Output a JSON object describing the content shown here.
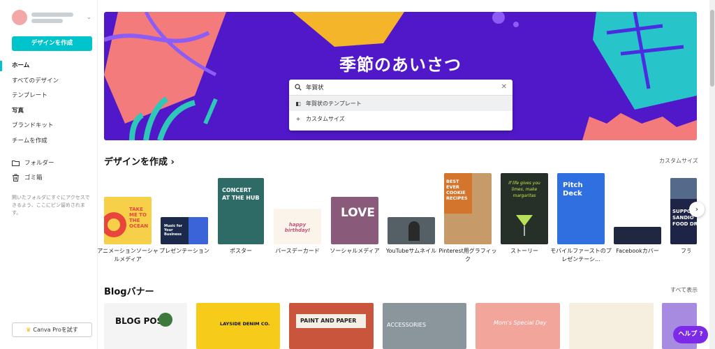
{
  "sidebar": {
    "create_button": "デザインを作成",
    "nav": [
      {
        "label": "ホーム",
        "active": true
      },
      {
        "label": "すべてのデザイン"
      },
      {
        "label": "テンプレート"
      },
      {
        "label": "写真",
        "bold": true
      },
      {
        "label": "ブランドキット"
      },
      {
        "label": "チームを作成"
      }
    ],
    "folders": "フォルダー",
    "trash": "ゴミ箱",
    "hint": "開いたフォルダにすぐにアクセスできるよう、ここにピン留めされます。",
    "pro_button": "Canva Proを試す"
  },
  "hero": {
    "title": "季節のあいさつ",
    "search_value": "年賀状",
    "suggestions": [
      {
        "icon": "template-icon",
        "label": "年賀状のテンプレート"
      },
      {
        "icon": "plus-icon",
        "label": "カスタムサイズ"
      }
    ]
  },
  "create_section": {
    "title": "デザインを作成",
    "chevron": "›",
    "link": "カスタムサイズ",
    "items": [
      {
        "label": "アニメーションソーシャルメディア",
        "text": "TAKE ME TO THE OCEAN"
      },
      {
        "label": "プレゼンテーション",
        "text": "Music for Your Business"
      },
      {
        "label": "ポスター",
        "text": "CONCERT AT THE HUB"
      },
      {
        "label": "バースデーカード",
        "text": "happy birthday!"
      },
      {
        "label": "ソーシャルメディア",
        "text": "LOVE"
      },
      {
        "label": "YouTubeサムネイル",
        "text": ""
      },
      {
        "label": "Pinterest用グラフィック",
        "text": "BEST EVER COOKIE RECIPES"
      },
      {
        "label": "ストーリー",
        "text": "If life gives you limes, make margaritas"
      },
      {
        "label": "モバイルファーストのプレゼンテーシ...",
        "text": "Pitch Deck"
      },
      {
        "label": "Facebookカバー",
        "text": ""
      },
      {
        "label": "フライ",
        "text": "SUPPORT SANDIO FOOD DR"
      }
    ]
  },
  "blog_section": {
    "title": "Blogバナー",
    "link": "すべて表示",
    "items": [
      {
        "text": "BLOG POST"
      },
      {
        "text": "LAYSIDE DENIM CO."
      },
      {
        "text": "PAINT AND PAPER"
      },
      {
        "text": "ACCESSORIES"
      },
      {
        "text": "Mom's Special Day"
      },
      {
        "text": ""
      },
      {
        "text": ""
      }
    ]
  },
  "help_button": "ヘルプ ?",
  "colors": {
    "accent": "#00c4cc",
    "hero_bg": "#5118c9",
    "help": "#7d2ae8"
  }
}
